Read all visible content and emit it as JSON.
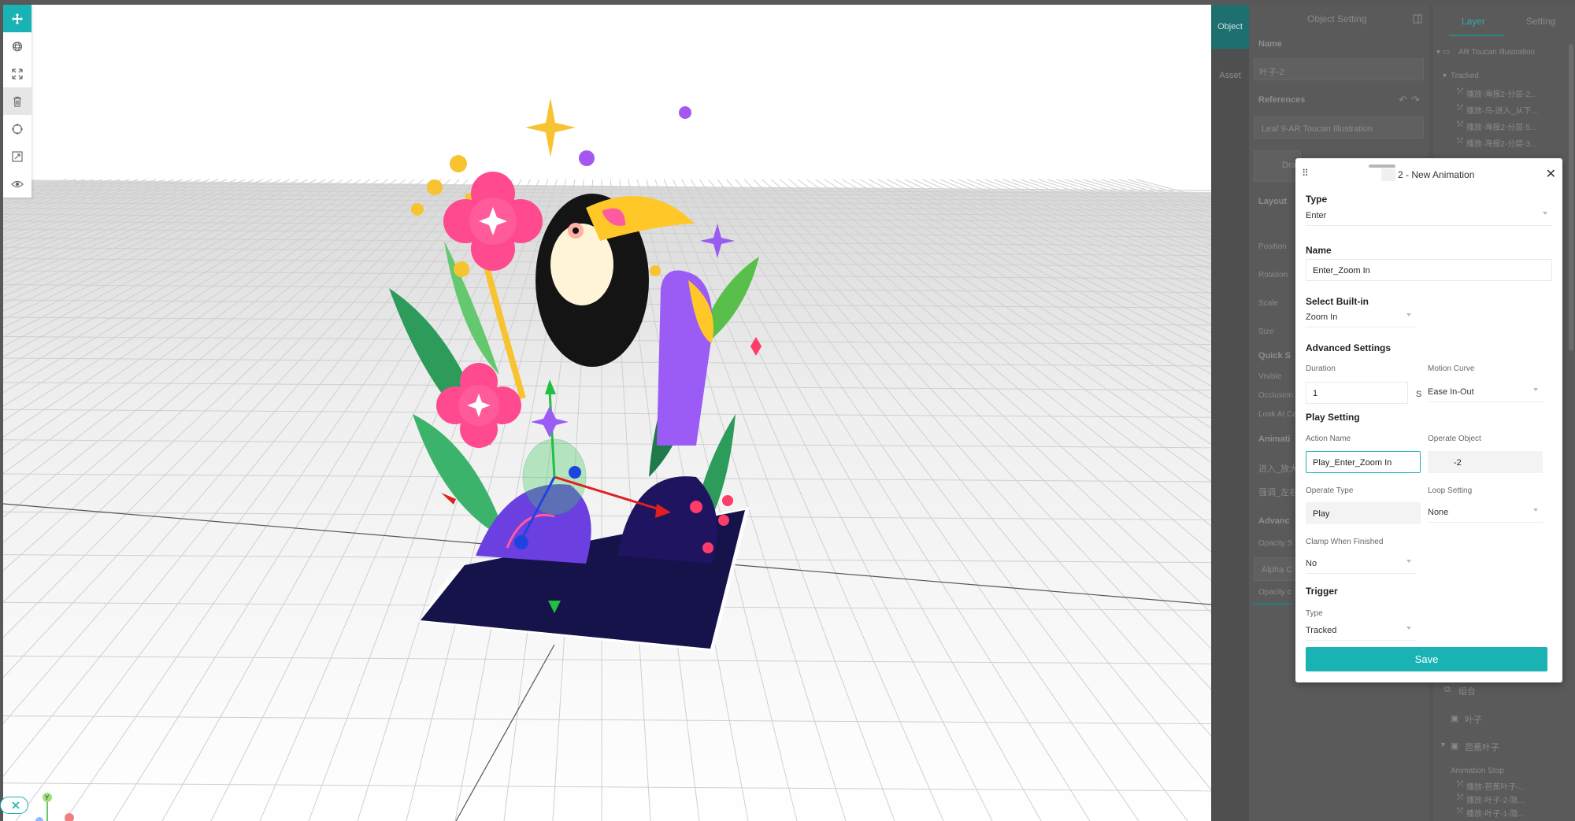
{
  "toolbar": {
    "tools": [
      "move-icon",
      "rotate-icon",
      "scale-icon",
      "delete-icon",
      "target-icon",
      "fit-icon",
      "eye-icon"
    ]
  },
  "object_tabs": {
    "object": "Object",
    "asset": "Asset"
  },
  "object_setting": {
    "title": "Object Setting",
    "name_label": "Name",
    "name_value": "叶子-2",
    "references_label": "References",
    "reference_value": "Leaf 9-AR Toucan Illustration",
    "ref_button_partial": "Dra",
    "layout_label": "Layout",
    "position_label": "Position",
    "rotation_label": "Rotation",
    "scale_label": "Scale",
    "size_label": "Size",
    "quick_label": "Quick S",
    "visible_label": "Visible",
    "occlusion_label": "Occlusion",
    "lookat_label": "Look At Ca",
    "animation_label": "Animati",
    "anim_item_1": "进入_放大",
    "anim_item_2": "强调_左右",
    "advanced_label": "Advanc",
    "opacity_s_label": "Opacity S",
    "alpha_value": "Alpha C",
    "opacity_c_label": "Opacity c"
  },
  "layer_panel": {
    "tab_layer": "Layer",
    "tab_setting": "Setting",
    "root_item": "AR Toucan Illustration",
    "tracked_label": "Tracked",
    "tracked_items": [
      "播放-海报2-分层-2...",
      "播放-鸟-进入_从下...",
      "播放-海报2-分层-5...",
      "播放-海报2-分层-3..."
    ],
    "group_item": "组合",
    "leaf_item": "叶子",
    "banana_item": "芭蕉叶子",
    "anim_stop_label": "Animation Stop",
    "anim_stop_items": [
      "播放-芭蕉叶子-...",
      "播放-叶子-2-隐...",
      "播放-叶子-1-隐..."
    ]
  },
  "modal": {
    "title": "2 - New Animation",
    "type_section": "Type",
    "type_value": "Enter",
    "name_section": "Name",
    "name_value": "Enter_Zoom In",
    "builtin_section": "Select Built-in",
    "builtin_value": "Zoom In",
    "advanced_section": "Advanced Settings",
    "duration_label": "Duration",
    "duration_value": "1",
    "duration_unit": "S",
    "motion_curve_label": "Motion Curve",
    "motion_curve_value": "Ease In-Out",
    "play_section": "Play Setting",
    "action_name_label": "Action Name",
    "action_name_value": "Play_Enter_Zoom In",
    "operate_object_label": "Operate Object",
    "operate_object_value": "-2",
    "operate_type_label": "Operate Type",
    "operate_type_value": "Play",
    "loop_label": "Loop Setting",
    "loop_value": "None",
    "clamp_label": "Clamp When Finished",
    "clamp_value": "No",
    "trigger_section": "Trigger",
    "trigger_type_label": "Type",
    "trigger_type_value": "Tracked",
    "save_label": "Save"
  },
  "gizmo": {
    "y_axis": "Y"
  },
  "colors": {
    "accent": "#1ab3b3",
    "panel_dim": "#5a5a5a"
  }
}
